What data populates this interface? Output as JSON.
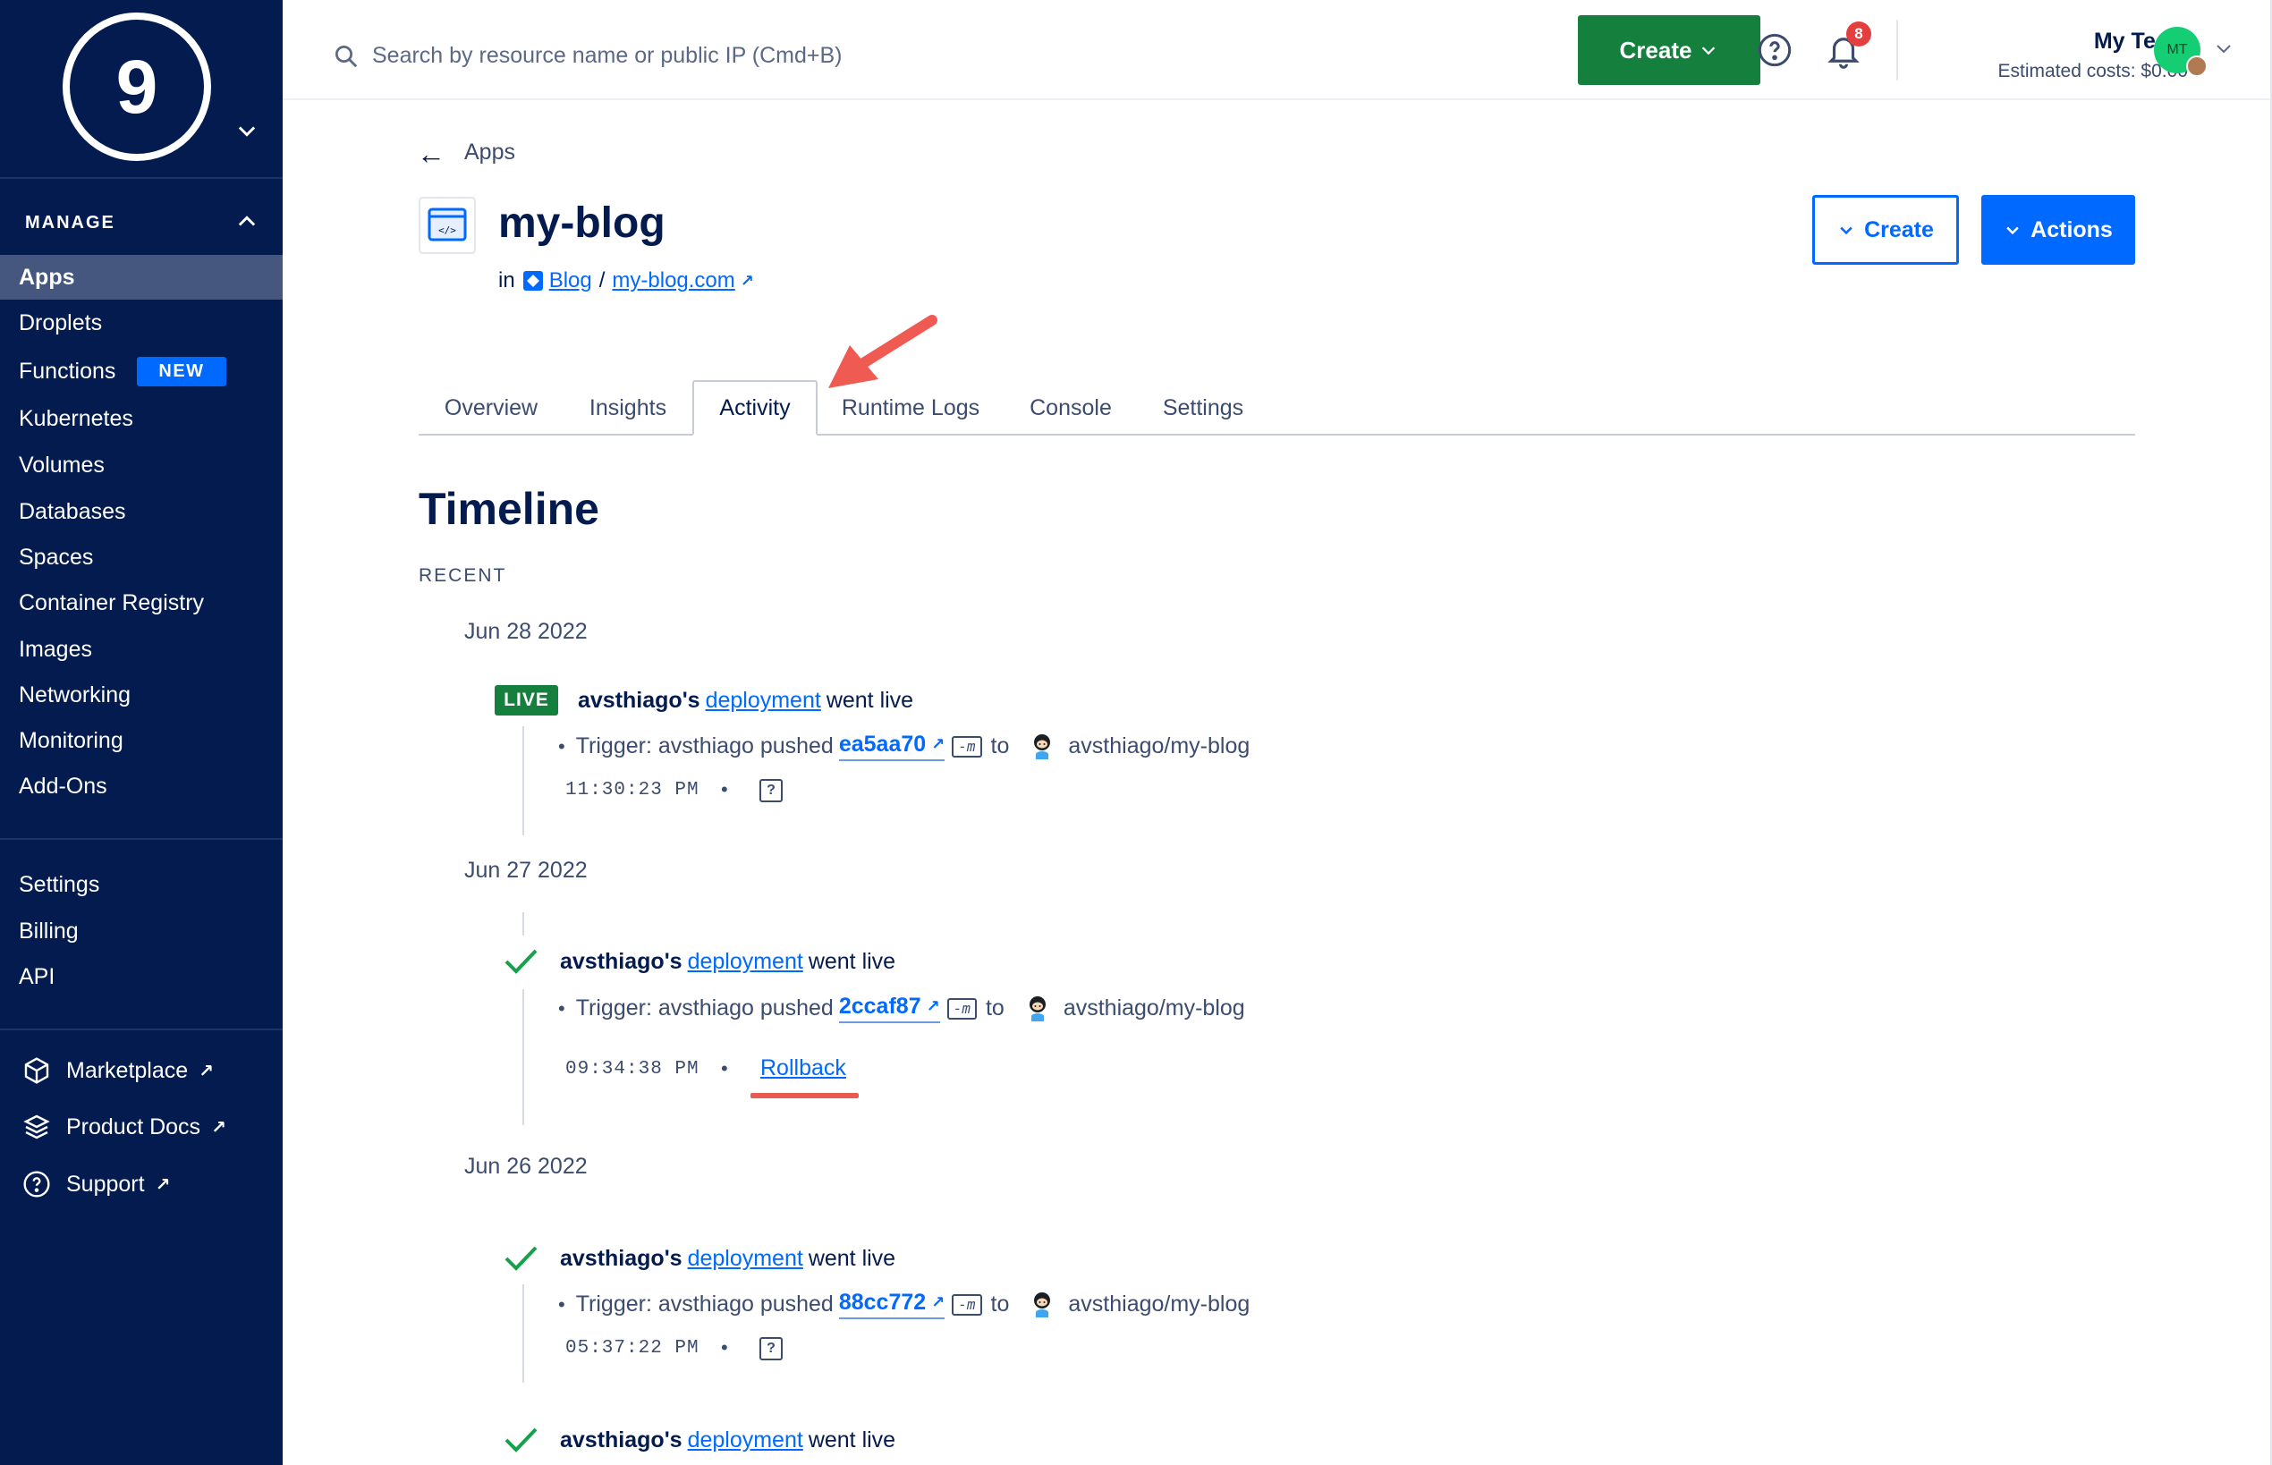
{
  "sidebar": {
    "logo_text": "9",
    "section": "MANAGE",
    "items": [
      {
        "label": "Apps",
        "active": true
      },
      {
        "label": "Droplets"
      },
      {
        "label": "Functions",
        "badge": "NEW"
      },
      {
        "label": "Kubernetes"
      },
      {
        "label": "Volumes"
      },
      {
        "label": "Databases"
      },
      {
        "label": "Spaces"
      },
      {
        "label": "Container Registry"
      },
      {
        "label": "Images"
      },
      {
        "label": "Networking"
      },
      {
        "label": "Monitoring"
      },
      {
        "label": "Add-Ons"
      }
    ],
    "account_items": [
      {
        "label": "Settings"
      },
      {
        "label": "Billing"
      },
      {
        "label": "API"
      }
    ],
    "external": [
      {
        "label": "Marketplace",
        "icon": "cube-icon"
      },
      {
        "label": "Product Docs",
        "icon": "layers-icon"
      },
      {
        "label": "Support",
        "icon": "help-circle-icon"
      }
    ]
  },
  "header": {
    "search_placeholder": "Search by resource name or public IP (Cmd+B)",
    "create_label": "Create",
    "notification_count": "8",
    "team_name": "My Team",
    "estimated_costs": "Estimated costs: $0.00",
    "avatar_initials": "MT"
  },
  "app": {
    "back_label": "Apps",
    "name": "my-blog",
    "in_label": "in",
    "project": "Blog",
    "separator": "/",
    "domain": "my-blog.com",
    "create_label": "Create",
    "actions_label": "Actions"
  },
  "tabs": [
    {
      "label": "Overview"
    },
    {
      "label": "Insights"
    },
    {
      "label": "Activity",
      "active": true
    },
    {
      "label": "Runtime Logs"
    },
    {
      "label": "Console"
    },
    {
      "label": "Settings"
    }
  ],
  "timeline": {
    "title": "Timeline",
    "section": "RECENT",
    "live_badge": "LIVE",
    "groups": [
      {
        "date": "Jun 28 2022",
        "event": {
          "user": "avsthiago's",
          "link": "deployment",
          "suffix": "went live",
          "status": "live",
          "trigger_prefix": "Trigger: avsthiago pushed",
          "commit": "ea5aa70",
          "flag": "-m",
          "to": "to",
          "repo": "avsthiago/my-blog",
          "time": "11:30:23 PM",
          "dot": "•",
          "help": "?"
        }
      },
      {
        "date": "Jun 27 2022",
        "event": {
          "user": "avsthiago's",
          "link": "deployment",
          "suffix": "went live",
          "status": "success",
          "trigger_prefix": "Trigger: avsthiago pushed",
          "commit": "2ccaf87",
          "flag": "-m",
          "to": "to",
          "repo": "avsthiago/my-blog",
          "time": "09:34:38 PM",
          "dot": "•",
          "action": "Rollback"
        }
      },
      {
        "date": "Jun 26 2022",
        "event": {
          "user": "avsthiago's",
          "link": "deployment",
          "suffix": "went live",
          "status": "success",
          "trigger_prefix": "Trigger: avsthiago pushed",
          "commit": "88cc772",
          "flag": "-m",
          "to": "to",
          "repo": "avsthiago/my-blog",
          "time": "05:37:22 PM",
          "dot": "•",
          "help": "?"
        },
        "event2": {
          "user": "avsthiago's",
          "link": "deployment",
          "suffix": "went live",
          "status": "success"
        }
      }
    ]
  },
  "colors": {
    "sidebar_bg": "#031b4e",
    "primary": "#0069ff",
    "success": "#15803d",
    "annotation": "#e85a52"
  }
}
